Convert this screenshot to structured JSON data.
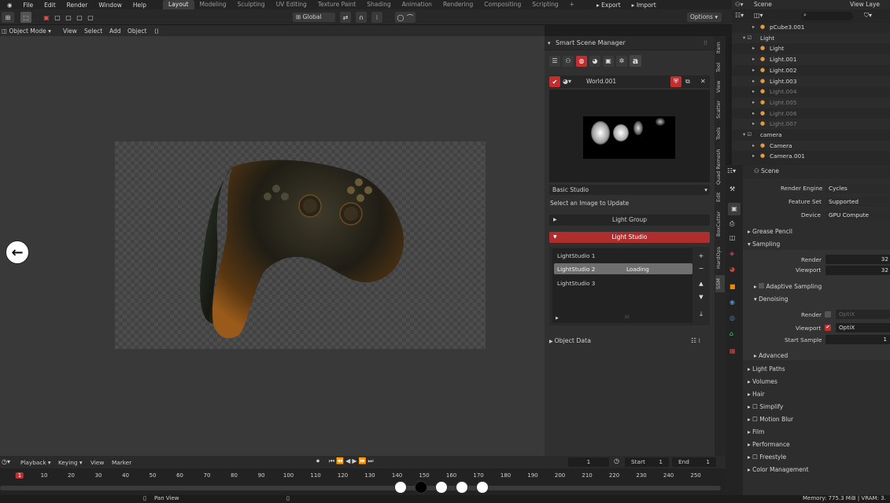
{
  "menu": [
    "File",
    "Edit",
    "Render",
    "Window",
    "Help"
  ],
  "workspace_tabs": [
    "Layout",
    "Modeling",
    "Sculpting",
    "UV Editing",
    "Texture Paint",
    "Shading",
    "Animation",
    "Rendering",
    "Compositing",
    "Scripting"
  ],
  "topbar_right": {
    "export": "Export",
    "import": "Import"
  },
  "outliner_header": {
    "scene": "Scene",
    "view_layer": "View Laye"
  },
  "toolbar": {
    "orientation": "Global",
    "options": "Options"
  },
  "viewport_header": {
    "mode": "Object Mode",
    "view": "View",
    "select": "Select",
    "add": "Add",
    "object": "Object"
  },
  "ssm": {
    "title": "Smart Scene Manager",
    "world_name": "World.001",
    "preset": "Basic Studio",
    "hint": "Select an Image to Update",
    "light_group": "Light Group",
    "light_studio": "Light Studio",
    "studios": [
      "LightStudio 1",
      "LightStudio 2",
      "LightStudio 3"
    ],
    "loading": "Loading",
    "object_data": "Object Data",
    "brand_letter": "a"
  },
  "vtabs": [
    "Item",
    "Tool",
    "View",
    "Scatter",
    "Tools",
    "Quad Remesh",
    "Edit",
    "BoxCutter",
    "HardOps",
    "SSM"
  ],
  "outliner": [
    {
      "name": "pCube3.001",
      "depth": 2,
      "dim": false
    },
    {
      "name": "Light",
      "depth": 1,
      "dim": false
    },
    {
      "name": "Light",
      "depth": 2,
      "dim": false
    },
    {
      "name": "Light.001",
      "depth": 2,
      "dim": false
    },
    {
      "name": "Light.002",
      "depth": 2,
      "dim": false
    },
    {
      "name": "Light.003",
      "depth": 2,
      "dim": false
    },
    {
      "name": "Light.004",
      "depth": 2,
      "dim": true
    },
    {
      "name": "Light.005",
      "depth": 2,
      "dim": true
    },
    {
      "name": "Light.006",
      "depth": 2,
      "dim": true
    },
    {
      "name": "Light.007",
      "depth": 2,
      "dim": true
    },
    {
      "name": "camera",
      "depth": 1,
      "dim": false
    },
    {
      "name": "Camera",
      "depth": 2,
      "dim": false
    },
    {
      "name": "Camera.001",
      "depth": 2,
      "dim": false
    }
  ],
  "props": {
    "scene": "Scene",
    "render_engine_label": "Render Engine",
    "render_engine": "Cycles",
    "feature_set_label": "Feature Set",
    "feature_set": "Supported",
    "device_label": "Device",
    "device": "GPU Compute",
    "grease_pencil": "Grease Pencil",
    "sampling": "Sampling",
    "render_label": "Render",
    "render_samples": "32",
    "viewport_label": "Viewport",
    "viewport_samples": "32",
    "adaptive": "Adaptive Sampling",
    "denoising": "Denoising",
    "den_render_label": "Render",
    "den_render": "OptiX",
    "den_viewport_label": "Viewport",
    "den_viewport": "OptiX",
    "start_sample_label": "Start Sample",
    "start_sample": "1",
    "advanced": "Advanced",
    "sections": [
      "Light Paths",
      "Volumes",
      "Hair",
      "Simplify",
      "Motion Blur",
      "Film",
      "Performance",
      "Freestyle",
      "Color Management"
    ]
  },
  "timeline": {
    "playback": "Playback",
    "keying": "Keying",
    "view": "View",
    "marker": "Marker",
    "current_frame": "1",
    "start_label": "Start",
    "start": "1",
    "end_label": "End",
    "end": "1",
    "ticks": [
      "1",
      "10",
      "20",
      "30",
      "40",
      "50",
      "60",
      "70",
      "80",
      "90",
      "100",
      "110",
      "120",
      "130",
      "140",
      "150",
      "160",
      "170",
      "180",
      "190",
      "200",
      "210",
      "220",
      "230",
      "240",
      "250"
    ]
  },
  "status": {
    "pan_view": "Pan View",
    "memory": "Memory: 775.3 MiB | VRAM: 3."
  },
  "carousel": {
    "prev": "←",
    "next": "→",
    "active_dot": 1
  }
}
